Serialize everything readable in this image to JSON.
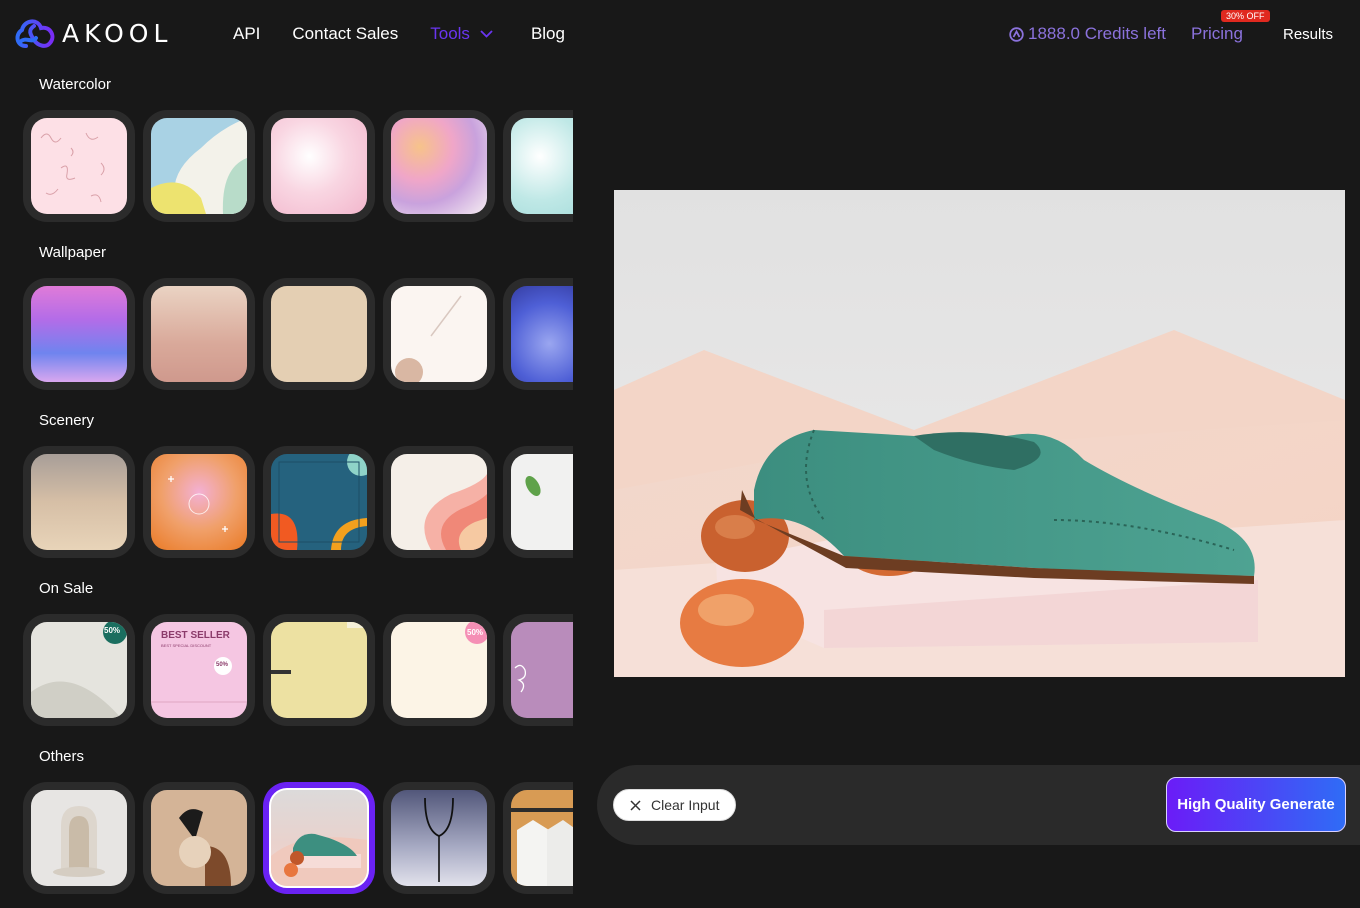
{
  "header": {
    "logo_text": "AKOOL",
    "nav": [
      {
        "label": "API"
      },
      {
        "label": "Contact Sales"
      },
      {
        "label": "Tools"
      },
      {
        "label": "Blog"
      }
    ],
    "credits": "1888.0 Credits left",
    "pricing": "Pricing",
    "discount_badge": "30% OFF",
    "results": "Results"
  },
  "sections": [
    {
      "title": "Watercolor"
    },
    {
      "title": "Wallpaper"
    },
    {
      "title": "Scenery"
    },
    {
      "title": "On Sale",
      "tile_texts": [
        "50%",
        "BEST SELLER",
        "BEST SPECIAL DISCOUNT",
        "50%",
        "50%"
      ]
    },
    {
      "title": "Others",
      "selected_index": 2
    }
  ],
  "bottom_bar": {
    "clear_label": "Clear Input",
    "generate_label": "High Quality Generate"
  },
  "colors": {
    "accent": "#6a22f4",
    "credits": "#8b72dc",
    "badge": "#e0291f"
  }
}
